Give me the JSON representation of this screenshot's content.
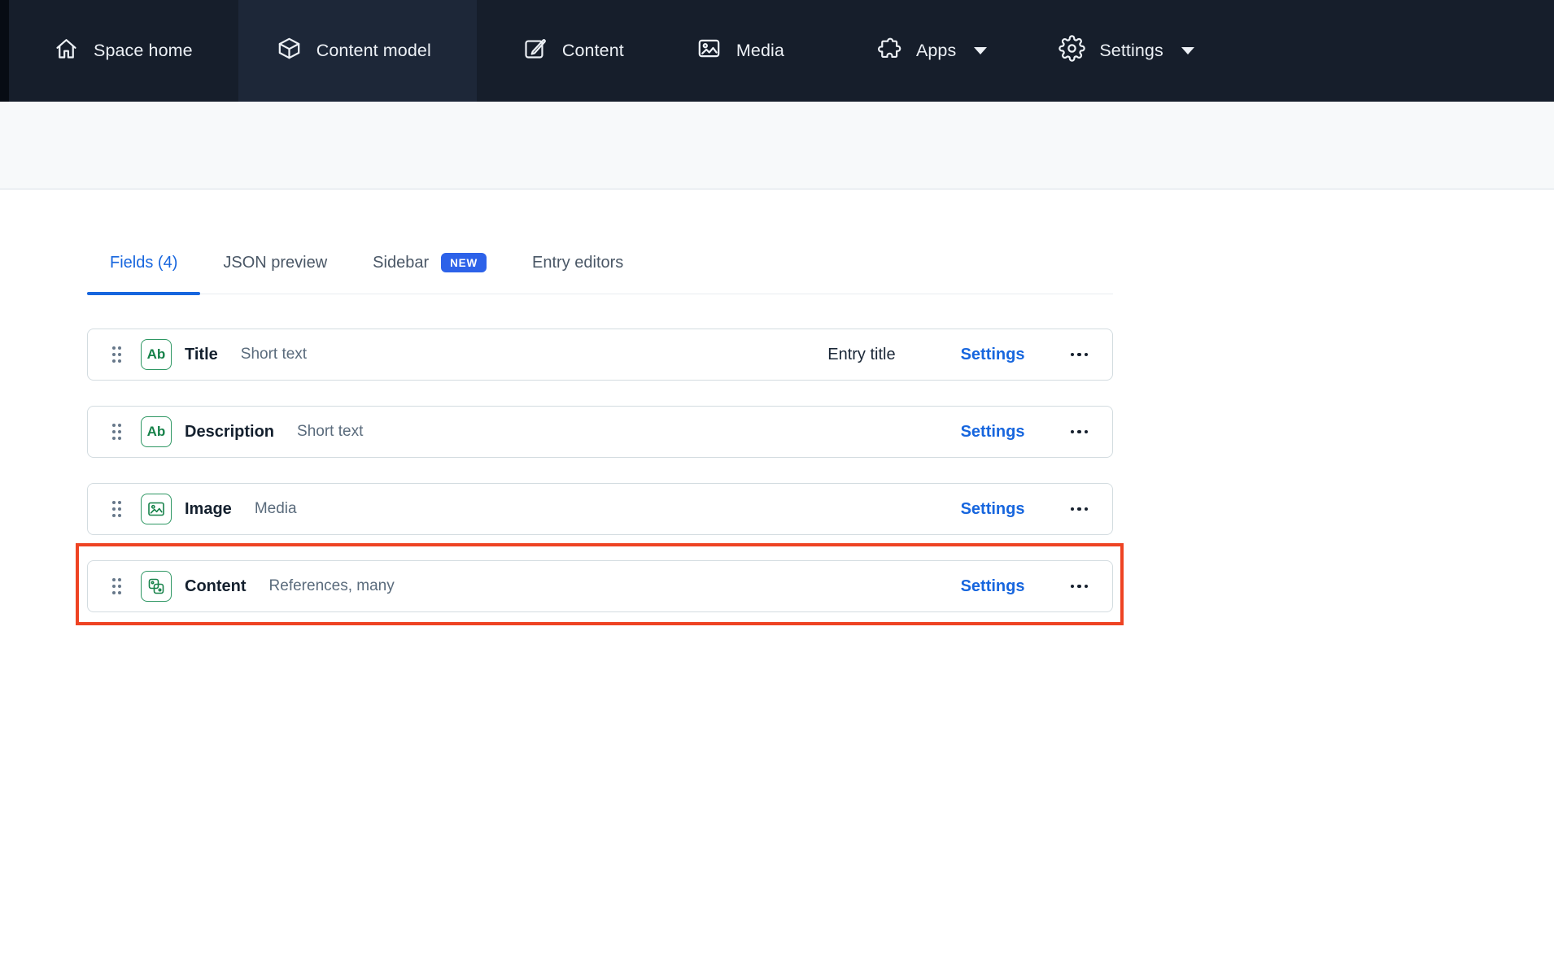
{
  "nav": {
    "items": [
      {
        "label": "Space home",
        "icon": "home-icon"
      },
      {
        "label": "Content model",
        "icon": "content-model-icon",
        "active": true
      },
      {
        "label": "Content",
        "icon": "content-icon"
      },
      {
        "label": "Media",
        "icon": "media-icon"
      },
      {
        "label": "Apps",
        "icon": "apps-icon",
        "has_dropdown": true
      },
      {
        "label": "Settings",
        "icon": "settings-icon",
        "has_dropdown": true
      }
    ]
  },
  "tabs": [
    {
      "label": "Fields (4)",
      "active": true
    },
    {
      "label": "JSON preview"
    },
    {
      "label": "Sidebar",
      "badge": "NEW"
    },
    {
      "label": "Entry editors"
    }
  ],
  "fields": [
    {
      "name": "Title",
      "type": "Short text",
      "icon_text": "Ab",
      "annotation": "Entry title",
      "settings": "Settings"
    },
    {
      "name": "Description",
      "type": "Short text",
      "icon_text": "Ab",
      "settings": "Settings"
    },
    {
      "name": "Image",
      "type": "Media",
      "settings": "Settings"
    },
    {
      "name": "Content",
      "type": "References, many",
      "settings": "Settings",
      "highlighted": true
    }
  ],
  "colors": {
    "nav_bg": "#161E2B",
    "nav_active_bg": "#1D2738",
    "accent_blue": "#1766DE",
    "badge_blue": "#2D62E9",
    "field_green": "#17824A",
    "highlight_red": "#EE4323",
    "subheader_bg": "#F7F9FA"
  }
}
